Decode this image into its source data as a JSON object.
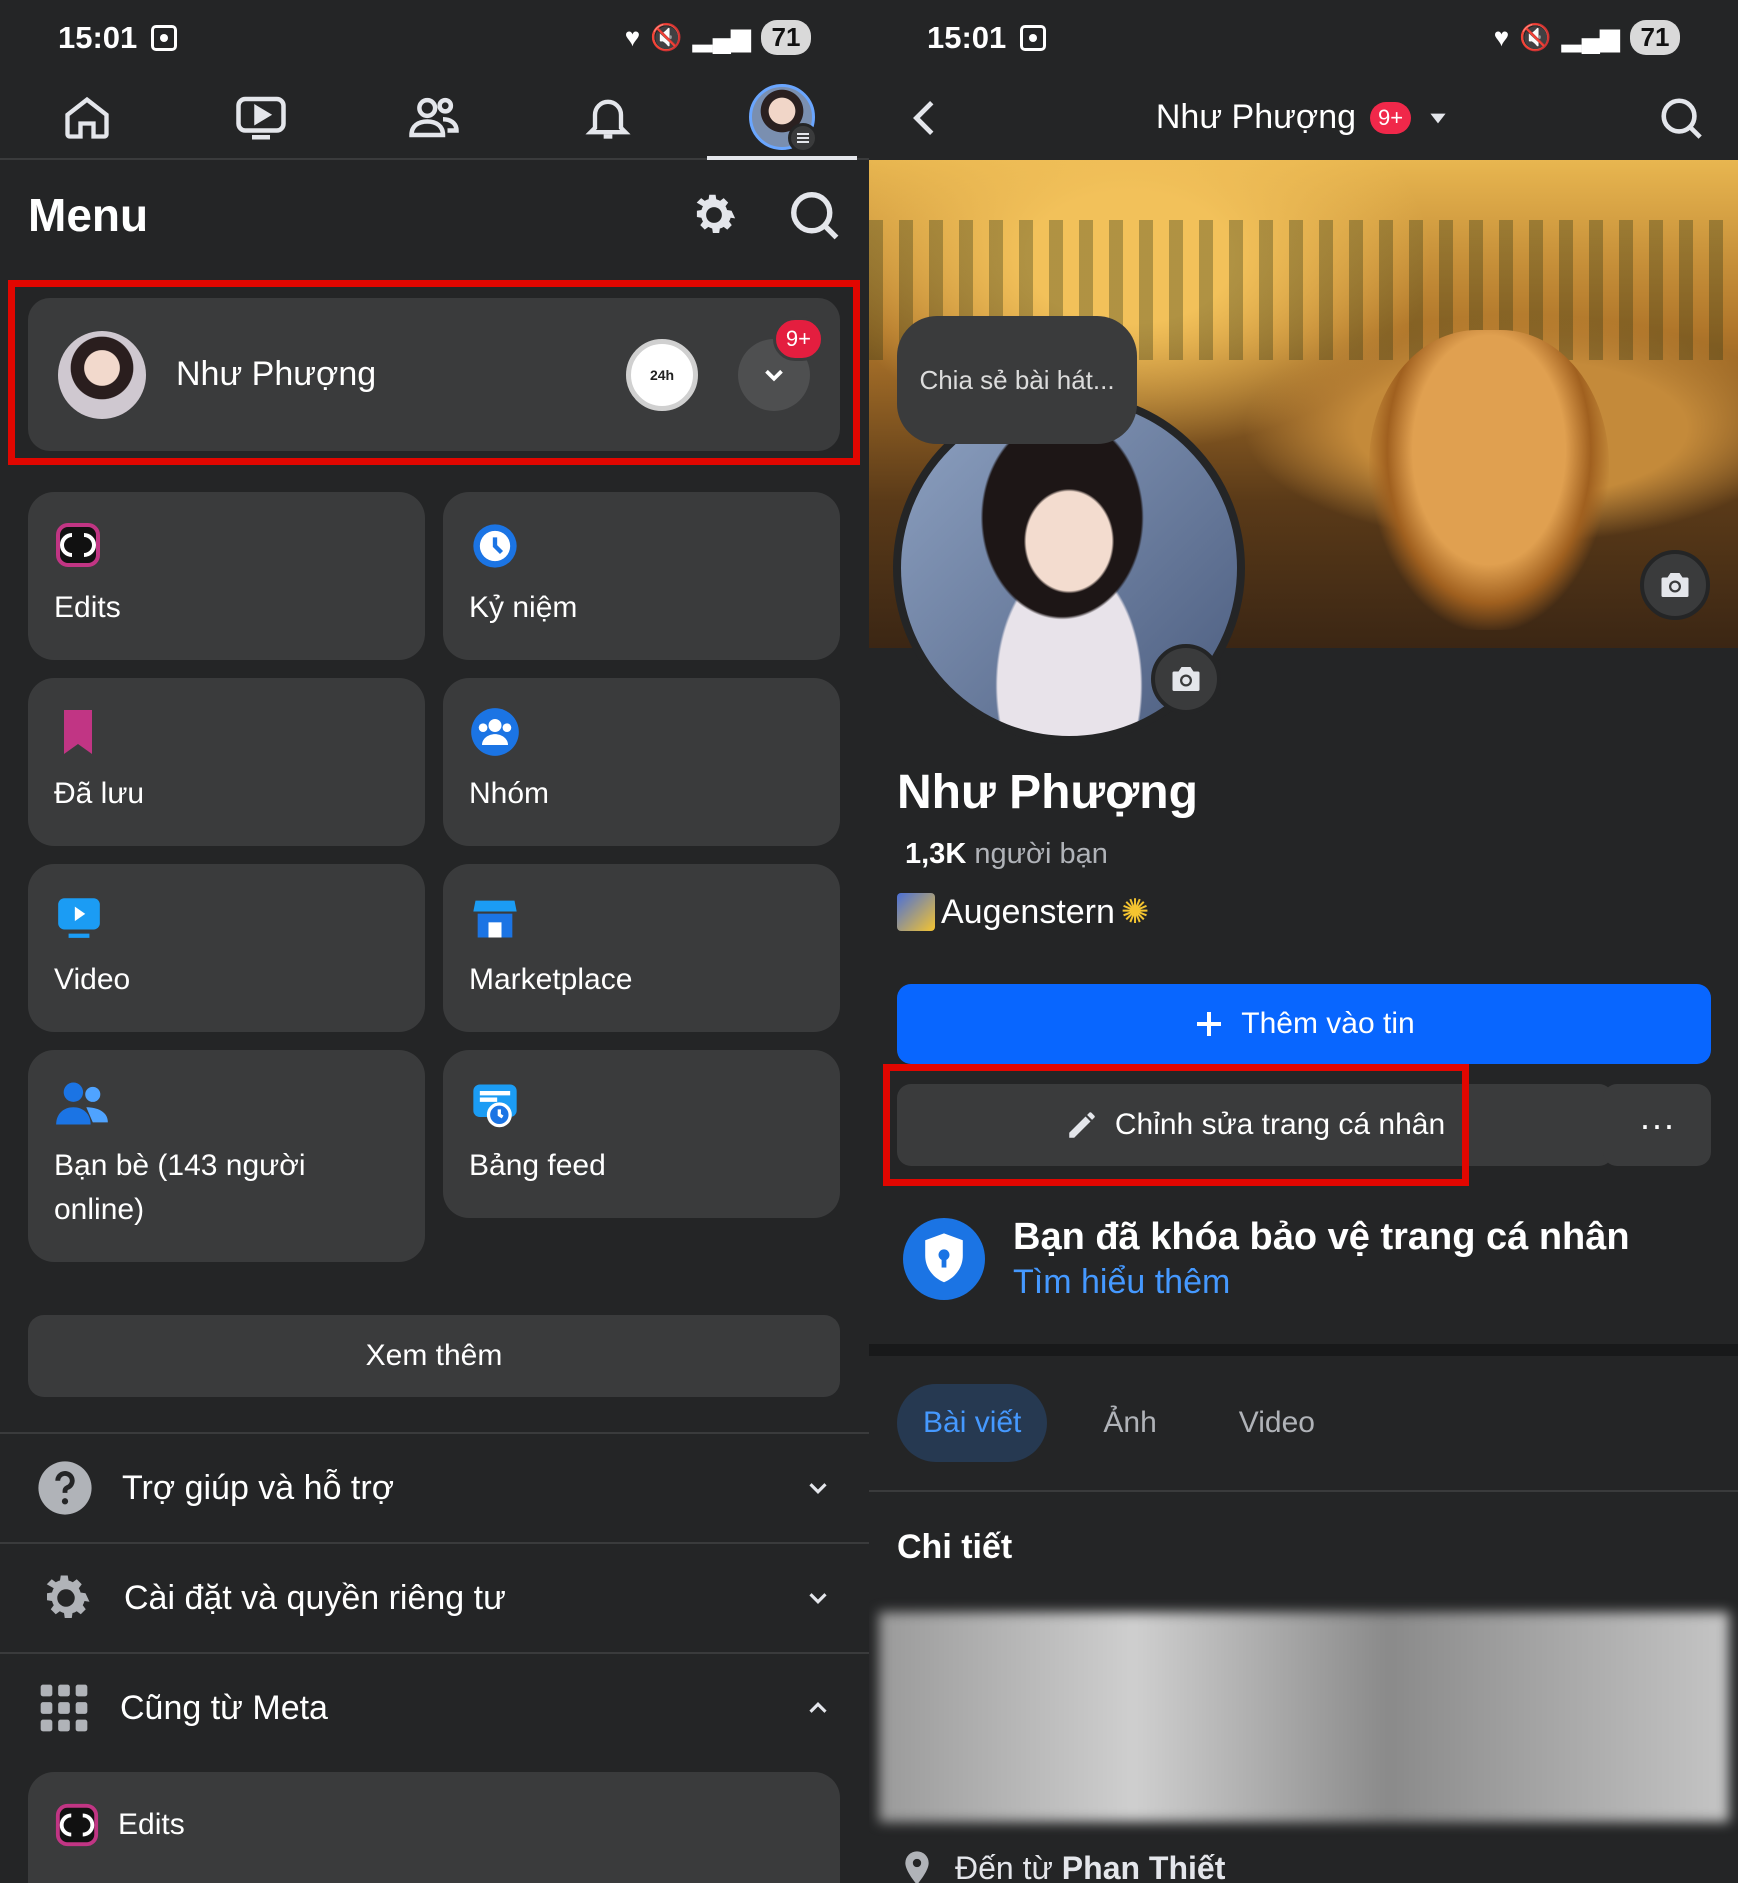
{
  "left": {
    "status": {
      "time": "15:01",
      "battery": "71"
    },
    "menu": {
      "title": "Menu"
    },
    "profile": {
      "name": "Như Phượng",
      "notif_badge": "9+",
      "story_label": "24h"
    },
    "shortcuts": [
      {
        "label": "Edits",
        "icon": "edits-icon"
      },
      {
        "label": "Kỷ niệm",
        "icon": "memories-icon"
      },
      {
        "label": "Đã lưu",
        "icon": "bookmark-icon"
      },
      {
        "label": "Nhóm",
        "icon": "groups-icon"
      },
      {
        "label": "Video",
        "icon": "video-icon"
      },
      {
        "label": "Marketplace",
        "icon": "marketplace-icon"
      },
      {
        "label": "Bạn bè (143 người online)",
        "icon": "friends-icon"
      },
      {
        "label": "Bảng feed",
        "icon": "feed-icon"
      }
    ],
    "see_more": "Xem thêm",
    "sections": [
      {
        "label": "Trợ giúp và hỗ trợ",
        "icon": "help-icon"
      },
      {
        "label": "Cài đặt và quyền riêng tư",
        "icon": "settings-icon"
      },
      {
        "label": "Cũng từ Meta",
        "icon": "apps-grid-icon"
      }
    ],
    "meta_items": [
      {
        "label": "Edits"
      }
    ]
  },
  "right": {
    "status": {
      "time": "15:01",
      "battery": "71"
    },
    "header": {
      "title": "Như Phượng",
      "badge": "9+"
    },
    "share_bubble": "Chia sẻ bài hát...",
    "name": "Như Phượng",
    "friends_count": "1,3K",
    "friends_label": "người bạn",
    "bio": "Augenstern",
    "add_story": "Thêm vào tin",
    "edit_profile": "Chỉnh sửa trang cá nhân",
    "more": "···",
    "lock": {
      "title": "Bạn đã khóa bảo vệ trang cá nhân",
      "link": "Tìm hiểu thêm"
    },
    "tabs": [
      "Bài viết",
      "Ảnh",
      "Video"
    ],
    "details_title": "Chi tiết",
    "from_prefix": "Đến từ",
    "from_place": "Phan Thiết"
  },
  "colors": {
    "accent": "#0866ff",
    "highlight": "#e10600",
    "badge": "#e41e3f"
  }
}
